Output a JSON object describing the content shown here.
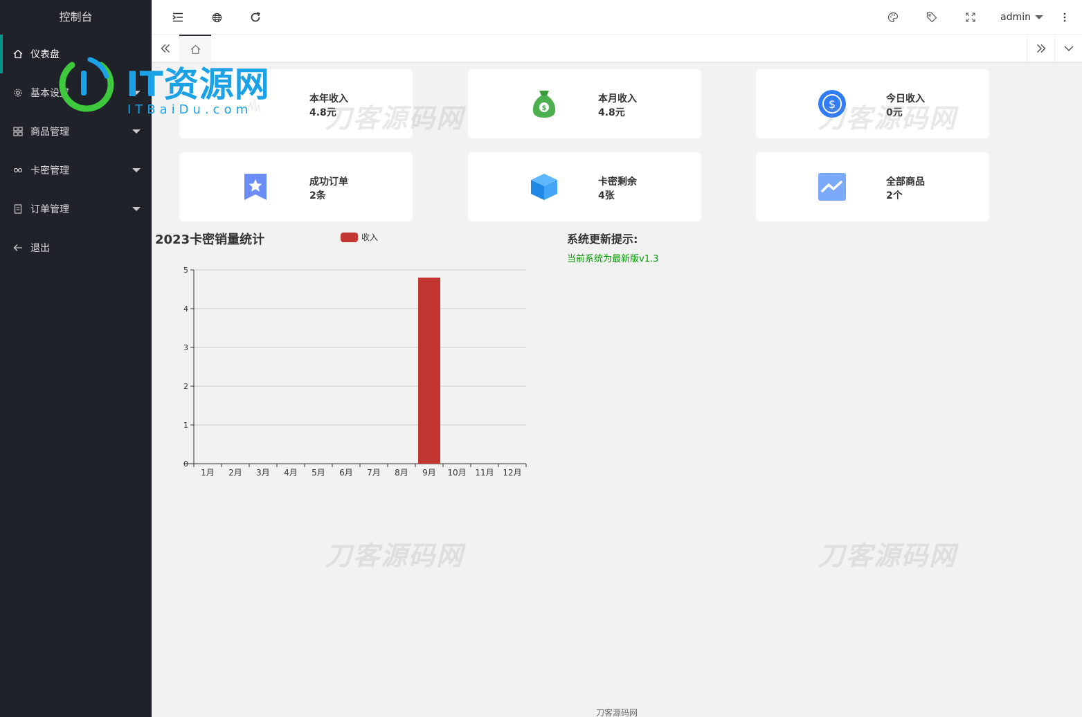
{
  "sidebar": {
    "title": "控制台",
    "items": [
      {
        "label": "仪表盘",
        "icon": "home-icon",
        "active": true,
        "has_caret": false
      },
      {
        "label": "基本设置",
        "icon": "gear-icon",
        "active": false,
        "has_caret": true
      },
      {
        "label": "商品管理",
        "icon": "grid-icon",
        "active": false,
        "has_caret": true
      },
      {
        "label": "卡密管理",
        "icon": "link-icon",
        "active": false,
        "has_caret": true
      },
      {
        "label": "订单管理",
        "icon": "document-icon",
        "active": false,
        "has_caret": true
      },
      {
        "label": "退出",
        "icon": "arrow-left-icon",
        "active": false,
        "has_caret": false
      }
    ]
  },
  "header": {
    "user": "admin"
  },
  "cards": [
    {
      "title": "本年收入",
      "value": "4.8元",
      "icon": "chart-icon"
    },
    {
      "title": "本月收入",
      "value": "4.8元",
      "icon": "money-bag-icon"
    },
    {
      "title": "今日收入",
      "value": "0元",
      "icon": "dollar-coin-icon"
    },
    {
      "title": "成功订单",
      "value": "2条",
      "icon": "star-badge-icon"
    },
    {
      "title": "卡密剩余",
      "value": "4张",
      "icon": "cube-icon"
    },
    {
      "title": "全部商品",
      "value": "2个",
      "icon": "trend-icon"
    }
  ],
  "chart": {
    "title": "2023卡密销量统计"
  },
  "chart_data": {
    "type": "bar",
    "title": "2023卡密销量统计",
    "categories": [
      "1月",
      "2月",
      "3月",
      "4月",
      "5月",
      "6月",
      "7月",
      "8月",
      "9月",
      "10月",
      "11月",
      "12月"
    ],
    "series": [
      {
        "name": "收入",
        "values": [
          0,
          0,
          0,
          0,
          0,
          0,
          0,
          0,
          4.8,
          0,
          0,
          0
        ],
        "color": "#c23531"
      }
    ],
    "ylim": [
      0,
      5
    ],
    "yticks": [
      0,
      1,
      2,
      3,
      4,
      5
    ],
    "grid": true,
    "legend": "top"
  },
  "notice": {
    "title": "系统更新提示:",
    "text": "当前系统为最新版v1.3"
  },
  "watermark": "刀客源码网",
  "footer": "刀客源码网",
  "logo": {
    "main": "IT资源网",
    "sub": "ITBaiDu.com"
  },
  "colors": {
    "sidebar_bg": "#20222a",
    "active_accent": "#009688",
    "bar": "#c23531",
    "notice_text": "#009900"
  }
}
